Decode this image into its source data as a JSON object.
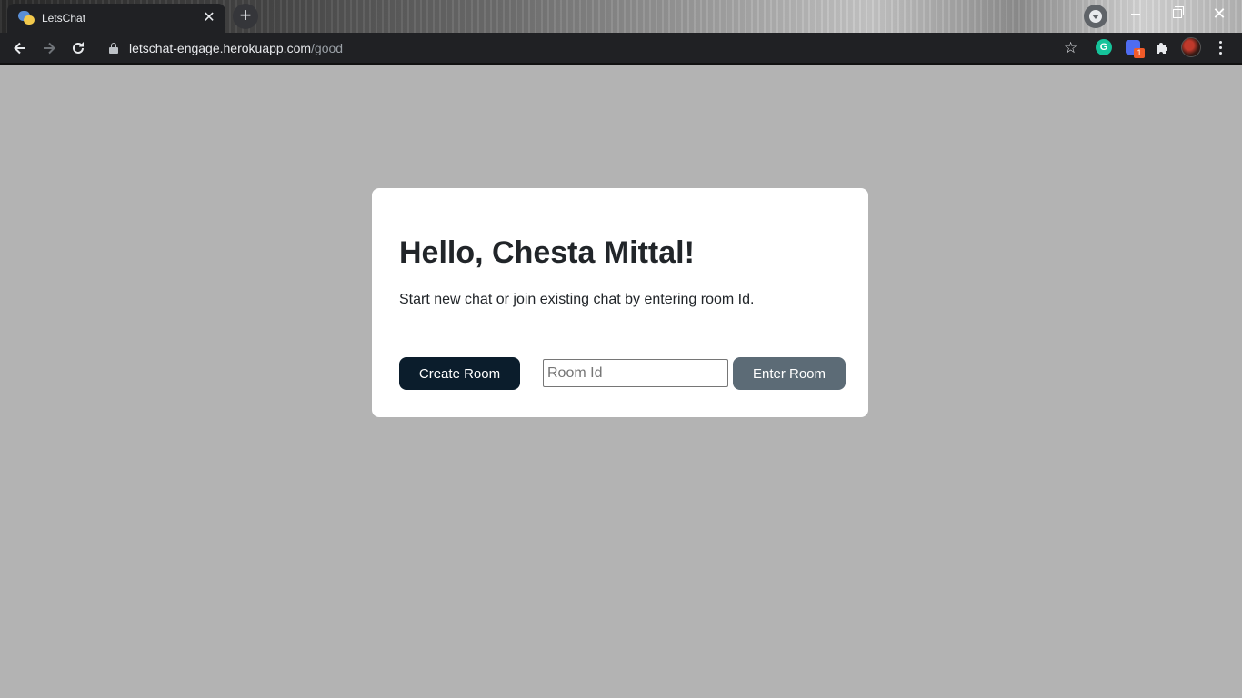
{
  "browser": {
    "tab": {
      "title": "LetsChat",
      "close_glyph": "✕",
      "favicon": "chat-bubbles-icon"
    },
    "new_tab_glyph": "+",
    "url": {
      "host": "letschat-engage.herokuapp.com",
      "path": "/good"
    },
    "bookmark_glyph": "☆",
    "extensions": {
      "grammarly_letter": "G",
      "badge_count": "1"
    },
    "window_close_glyph": "✕"
  },
  "page": {
    "heading": "Hello, Chesta Mittal!",
    "subtitle": "Start new chat or join existing chat by entering room Id.",
    "create_button": "Create Room",
    "room_input": {
      "placeholder": "Room Id",
      "value": ""
    },
    "enter_button": "Enter Room"
  },
  "colors": {
    "page_background": "#b3b3b3",
    "card_background": "#ffffff",
    "create_button": "#0b1d2c",
    "enter_button": "#5c6b76",
    "text": "#212529"
  }
}
